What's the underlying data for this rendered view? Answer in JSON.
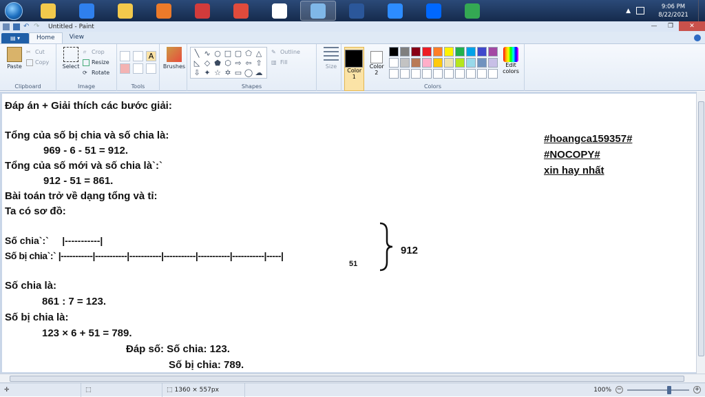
{
  "taskbar": {
    "apps": [
      {
        "name": "explorer-icon",
        "color": "#f2c94c"
      },
      {
        "name": "ie-icon",
        "color": "#2f80ed"
      },
      {
        "name": "folder-icon",
        "color": "#f2c94c"
      },
      {
        "name": "media-player-icon",
        "color": "#eb7a2a"
      },
      {
        "name": "snipping-tool-icon",
        "color": "#d23b3b"
      },
      {
        "name": "app-icon",
        "color": "#e04b3c"
      },
      {
        "name": "pdf-editor-icon",
        "color": "#ffffff"
      },
      {
        "name": "paint-icon",
        "color": "#7fb7e8"
      },
      {
        "name": "word-icon",
        "color": "#2b579a"
      },
      {
        "name": "zoom-icon",
        "color": "#2d8cff"
      },
      {
        "name": "zalo-icon",
        "color": "#0068ff"
      },
      {
        "name": "chrome-icon",
        "color": "#34a853"
      }
    ],
    "clock_time": "9:06 PM",
    "clock_date": "8/22/2021"
  },
  "window": {
    "title": "Untitled - Paint"
  },
  "tabs": {
    "file": "",
    "home": "Home",
    "view": "View"
  },
  "ribbon": {
    "clipboard": {
      "paste": "Paste",
      "cut": "Cut",
      "copy": "Copy",
      "label": "Clipboard"
    },
    "image": {
      "select": "Select",
      "crop": "Crop",
      "resize": "Resize",
      "rotate": "Rotate",
      "label": "Image"
    },
    "tools": {
      "label": "Tools"
    },
    "brushes": {
      "label": "Brushes"
    },
    "shapes": {
      "outline": "Outline",
      "fill": "Fill",
      "label": "Shapes"
    },
    "size": {
      "label": "Size"
    },
    "colors": {
      "color1": "Color 1",
      "color2": "Color 2",
      "edit": "Edit colors",
      "label": "Colors",
      "palette": [
        "#000000",
        "#7f7f7f",
        "#880015",
        "#ed1c24",
        "#ff7f27",
        "#fff200",
        "#22b14c",
        "#00a2e8",
        "#3f48cc",
        "#a349a4",
        "#ffffff",
        "#c3c3c3",
        "#b97a57",
        "#ffaec9",
        "#ffc90e",
        "#efe4b0",
        "#b5e61d",
        "#99d9ea",
        "#7092be",
        "#c8bfe7",
        "#ffffff",
        "#ffffff",
        "#ffffff",
        "#ffffff",
        "#ffffff",
        "#ffffff",
        "#ffffff",
        "#ffffff",
        "#ffffff",
        "#ffffff"
      ]
    }
  },
  "canvas": {
    "line1": "Đáp án + Giải thích các bước giải:",
    "line2": "Tổng của số bị chia và số chia là:",
    "line3": "969 - 6 - 51 = 912.",
    "line4": "Tổng của số mới và số chia là`:`",
    "line5": "912 - 51 = 861.",
    "line6": "Bài toán trở về dạng tổng và tỉ:",
    "line7": "Ta có sơ đồ:",
    "diag_divisor": "Số chia`:`     |-----------|",
    "diag_dividend": "Số bị chia`:` |-----------|-----------|-----------|-----------|-----------|-----------|-----|",
    "diag_51": "51",
    "diag_912": "912",
    "line8": "Số chia là:",
    "line9": "861 : 7 = 123.",
    "line10": "Số bị chia là:",
    "line11": "123 × 6 + 51 = 789.",
    "ans1": "Đáp số: Số chia: 123.",
    "ans2": "Số bị chia: 789.",
    "tag1": "#hoangca159357#",
    "tag2": "#NOCOPY#",
    "tag3": "xin hay nhất"
  },
  "status": {
    "dimensions": "1360 × 557px",
    "zoom": "100%"
  }
}
